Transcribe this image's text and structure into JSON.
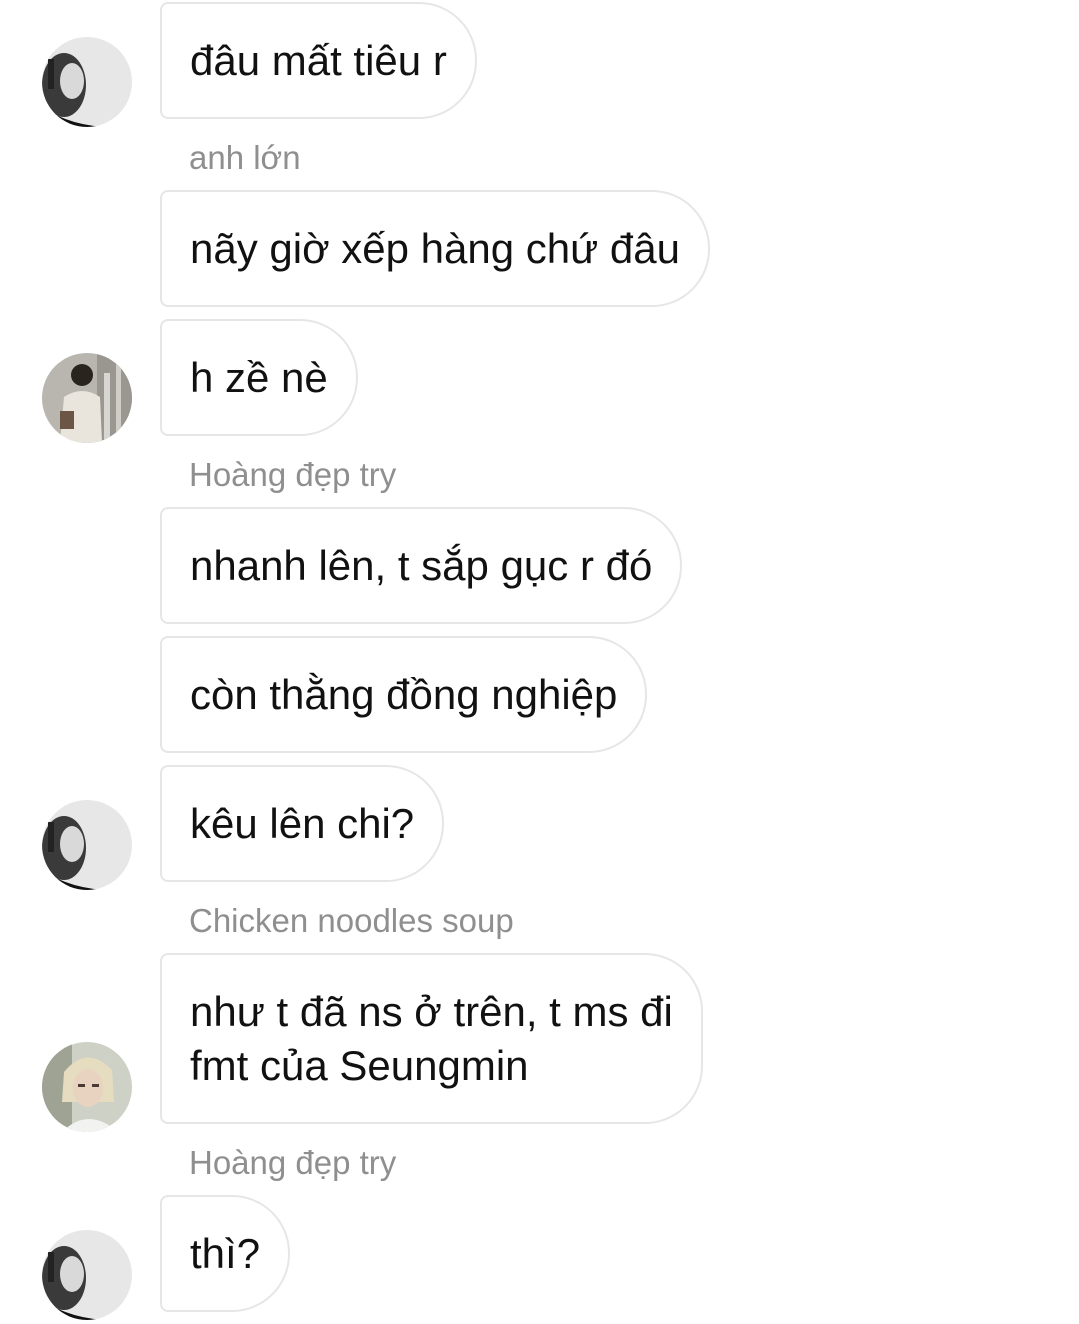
{
  "messages": [
    {
      "text": "đâu mất tiêu r"
    },
    {
      "sender": "anh lớn",
      "text": "nãy giờ xếp hàng chứ đâu"
    },
    {
      "text": "h zề nè"
    },
    {
      "sender": "Hoàng đẹp try",
      "text": "nhanh lên, t sắp gục r đó"
    },
    {
      "text": "còn thằng đồng nghiệp"
    },
    {
      "text": "kêu lên chi?"
    },
    {
      "sender": "Chicken noodles soup",
      "text_line1": "như t đã ns ở trên, t ms đi",
      "text_line2": "fmt của Seungmin"
    },
    {
      "sender": "Hoàng đẹp try",
      "text": "thì?"
    }
  ],
  "avatars": [
    {
      "icon": "grayscale-profile-photo-icon"
    },
    {
      "icon": "street-photo-avatar-icon"
    },
    {
      "icon": "grayscale-profile-photo-icon"
    },
    {
      "icon": "blonde-portrait-avatar-icon"
    },
    {
      "icon": "grayscale-profile-photo-icon"
    }
  ]
}
